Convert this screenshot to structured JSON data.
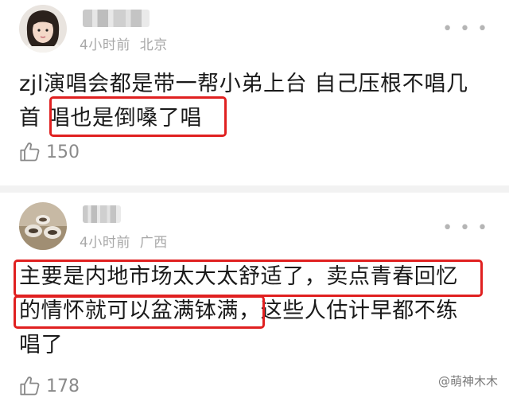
{
  "comments": [
    {
      "time": "4小时前",
      "location": "北京",
      "text_line1": "zjl演唱会都是带一帮小弟上台 自己压根不唱几",
      "text_line2": "首 唱也是倒嗓了唱",
      "likes": "150"
    },
    {
      "time": "4小时前",
      "location": "广西",
      "text_line1": "主要是内地市场太大太舒适了，卖点青春回忆",
      "text_line2": "的情怀就可以盆满钵满，这些人估计早都不练",
      "text_line3": "唱了",
      "likes": "178"
    }
  ],
  "more_icon": "ellipsis-icon",
  "like_icon": "thumbs-up-icon",
  "watermark": "@萌神木木",
  "colors": {
    "highlight": "#e02020",
    "meta": "#a8a8a8",
    "text": "#1a1a1a"
  }
}
